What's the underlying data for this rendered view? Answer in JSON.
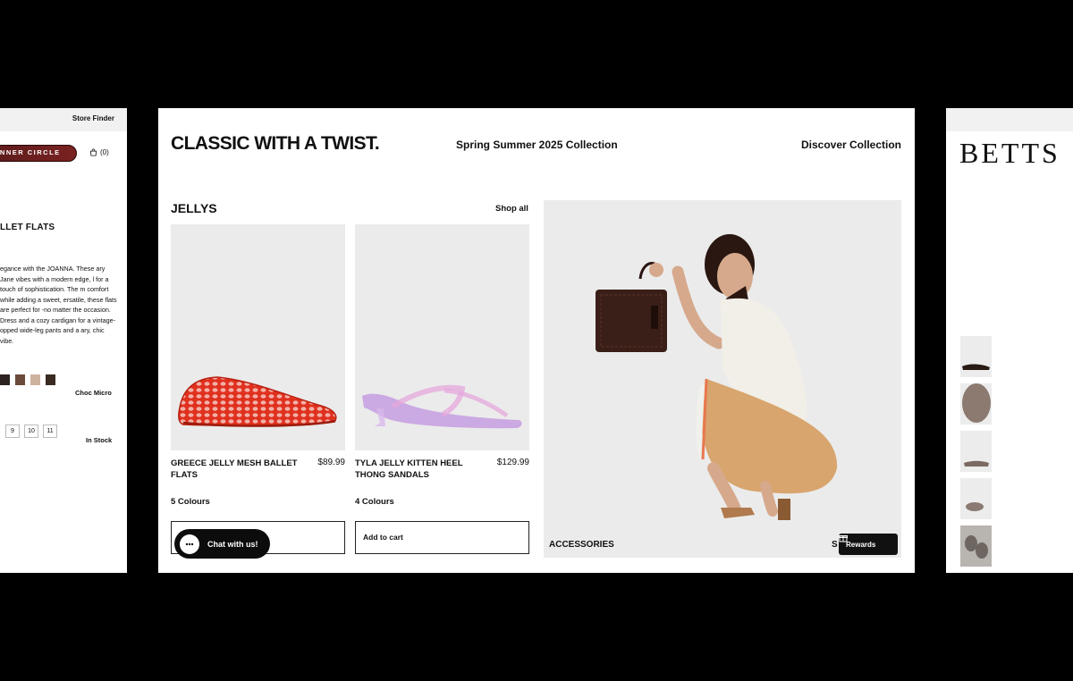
{
  "left_panel": {
    "store_finder": "Store Finder",
    "inner_circle": "INNER CIRCLE",
    "cart_count": "(0)",
    "product_title": "LLET FLATS",
    "description": "egance with the JOANNA. These ary Jane vibes with a modern edge, l for a touch of sophistication. The m comfort while adding a sweet, ersatile, these flats are perfect for -no matter the occasion. Dress and a cozy cardigan for a vintage- opped wide-leg pants and a ary, chic vibe.",
    "swatches": [
      "#2b2420",
      "#6b4a3c",
      "#cdb29f",
      "#3a2a22"
    ],
    "color_name": "Choc Micro",
    "sizes": [
      "9",
      "10",
      "11"
    ],
    "stock": "In Stock"
  },
  "main": {
    "hero_title": "CLASSIC WITH A TWIST.",
    "collection": "Spring Summer 2025 Collection",
    "discover": "Discover Collection",
    "section_title": "JELLYS",
    "shop_all": "Shop all",
    "products": [
      {
        "name": "GREECE JELLY MESH BALLET FLATS",
        "price": "$89.99",
        "colours": "5 Colours",
        "cart": ""
      },
      {
        "name": "TYLA JELLY KITTEN HEEL THONG SANDALS",
        "price": "$129.99",
        "colours": "4 Colours",
        "cart": "Add to cart"
      }
    ],
    "feature_label": "ACCESSORIES",
    "feature_s": "S",
    "rewards": "Rewards",
    "chat": "Chat with us!"
  },
  "right_panel": {
    "logo": "BETTS"
  },
  "colors": {
    "accent": "#111111",
    "inner_circle": "#6b1e1e",
    "card_bg": "#ebebeb"
  }
}
